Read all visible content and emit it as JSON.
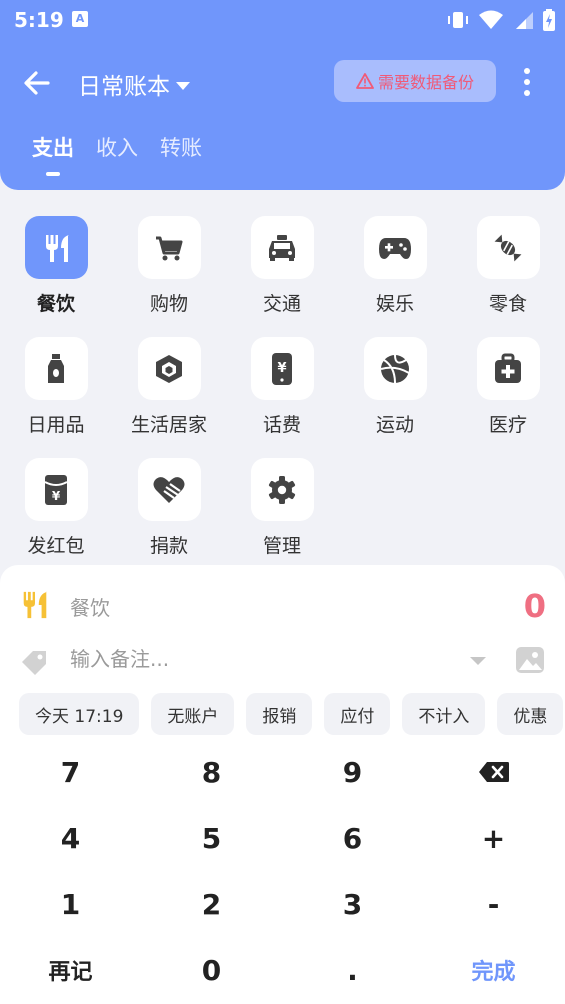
{
  "status_bar": {
    "time": "5:19",
    "notification_icon": "A"
  },
  "toolbar": {
    "book_title": "日常账本",
    "backup_badge": "需要数据备份"
  },
  "tabs": [
    {
      "label": "支出",
      "active": true
    },
    {
      "label": "收入",
      "active": false
    },
    {
      "label": "转账",
      "active": false
    }
  ],
  "categories": [
    {
      "label": "餐饮",
      "icon": "utensils-icon",
      "selected": true
    },
    {
      "label": "购物",
      "icon": "cart-icon"
    },
    {
      "label": "交通",
      "icon": "taxi-icon"
    },
    {
      "label": "娱乐",
      "icon": "gamepad-icon"
    },
    {
      "label": "零食",
      "icon": "candy-icon"
    },
    {
      "label": "日用品",
      "icon": "bottle-icon"
    },
    {
      "label": "生活居家",
      "icon": "home-cube-icon"
    },
    {
      "label": "话费",
      "icon": "phone-bill-icon"
    },
    {
      "label": "运动",
      "icon": "basketball-icon"
    },
    {
      "label": "医疗",
      "icon": "medical-kit-icon"
    },
    {
      "label": "发红包",
      "icon": "red-packet-icon"
    },
    {
      "label": "捐款",
      "icon": "heart-hand-icon"
    },
    {
      "label": "管理",
      "icon": "gear-icon"
    }
  ],
  "entry": {
    "category": "餐饮",
    "amount": "0",
    "note_placeholder": "输入备注..."
  },
  "chips": [
    "今天 17:19",
    "无账户",
    "报销",
    "应付",
    "不计入",
    "优惠"
  ],
  "keypad": {
    "rows": [
      [
        "7",
        "8",
        "9",
        "backspace"
      ],
      [
        "4",
        "5",
        "6",
        "+"
      ],
      [
        "1",
        "2",
        "3",
        "-"
      ],
      [
        "再记",
        "0",
        ".",
        "完成"
      ]
    ]
  },
  "colors": {
    "accent": "#7096fb",
    "amount": "#ef6f82",
    "warning": "#f05a78",
    "icon_yellow": "#f6c136"
  }
}
